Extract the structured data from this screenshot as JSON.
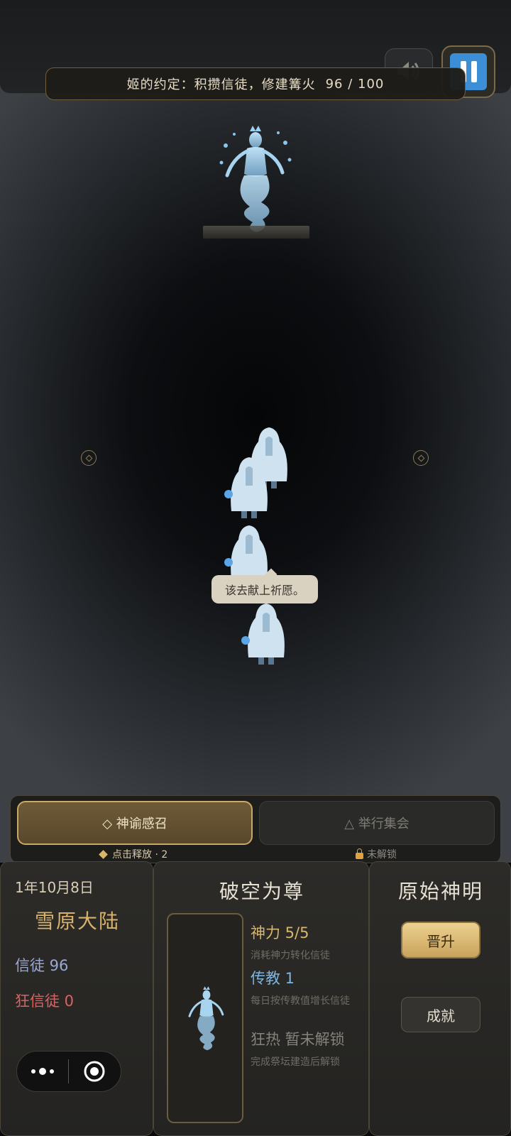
{
  "hud": {
    "quest_text": "姬的约定：积攒信徒，修建篝火",
    "quest_progress": "96 / 100",
    "sound_icon": "speaker-icon",
    "pause_icon": "pause-icon"
  },
  "scene": {
    "speech_text": "该去献上祈愿。",
    "follower_count_visible": 4
  },
  "actions": {
    "oracle_label": "◇ 神谕感召",
    "oracle_sub": "点击释放 · 2",
    "assembly_label": "△ 举行集会",
    "assembly_sub": "未解锁"
  },
  "status": {
    "date": "1年10月8日",
    "region": "雪原大陆",
    "believers": "信徒 96",
    "zealots": "狂信徒 0"
  },
  "realm": {
    "title": "破空为尊",
    "stats": [
      {
        "main": "神力 5/5",
        "sub": "消耗神力转化信徒"
      },
      {
        "main": "传教 1",
        "sub": "每日按传教值增长信徒"
      },
      {
        "main": "狂热 暂未解锁",
        "sub": "完成祭坛建造后解锁"
      }
    ]
  },
  "rank": {
    "title": "原始神明",
    "promote_label": "晋升",
    "achievement_label": "成就"
  },
  "colors": {
    "gold": "#d8b66c",
    "believer_blue": "#9aa8d6",
    "zealot_red": "#d86363",
    "pause_blue": "#3c8ed6"
  }
}
